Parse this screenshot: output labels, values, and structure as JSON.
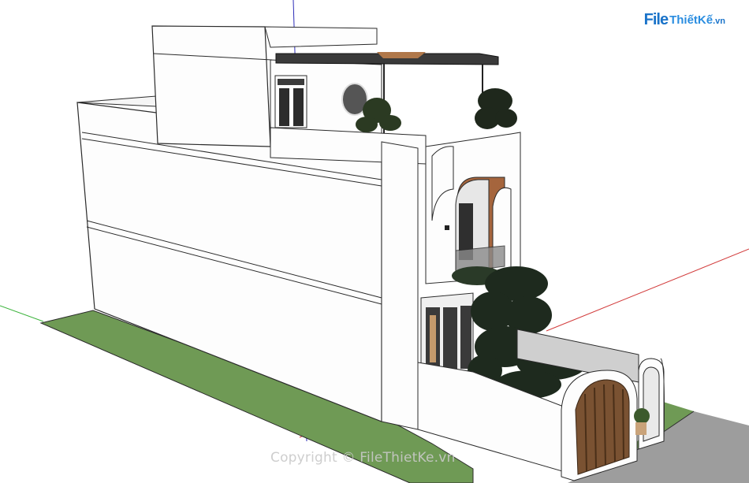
{
  "watermark": {
    "logo_file": "File",
    "logo_rest": "ThiếtKế",
    "logo_tld": ".vn",
    "copyright": "Copyright © FileThietKe.vn"
  },
  "colors": {
    "ground": "#6f9a55",
    "road": "#9d9d9d",
    "wall": "#fdfdfd",
    "edge": "#2b2b2b",
    "tree": "#1e2a1e",
    "wood": "#7a5232",
    "brick": "#a5653d"
  }
}
